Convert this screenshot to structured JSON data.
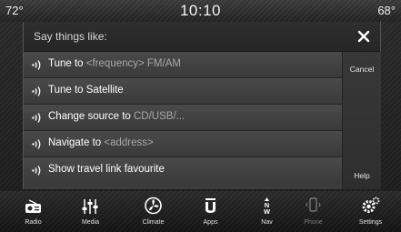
{
  "status_bar": {
    "temp_left": "72°",
    "clock": "10:10",
    "temp_right": "68°"
  },
  "dialog": {
    "title": "Say things like:",
    "commands": [
      {
        "label": "Tune to",
        "hint": "<frequency> FM/AM"
      },
      {
        "label": "Tune to Satellite",
        "hint": ""
      },
      {
        "label": "Change source to",
        "hint": "CD/USB/..."
      },
      {
        "label": "Navigate to",
        "hint": "<address>"
      },
      {
        "label": "Show travel link favourite",
        "hint": ""
      }
    ],
    "cancel_label": "Cancel",
    "help_label": "Help"
  },
  "nav": {
    "items": [
      {
        "label": "Radio",
        "icon": "radio-icon",
        "enabled": true
      },
      {
        "label": "Media",
        "icon": "media-icon",
        "enabled": true
      },
      {
        "label": "Climate",
        "icon": "climate-icon",
        "enabled": true
      },
      {
        "label": "Apps",
        "icon": "apps-icon",
        "enabled": true
      },
      {
        "label": "Nav",
        "icon": "nav-icon",
        "enabled": true
      },
      {
        "label": "Phone",
        "icon": "phone-icon",
        "enabled": false
      },
      {
        "label": "Settings",
        "icon": "settings-icon",
        "enabled": true
      }
    ]
  },
  "colors": {
    "background": "#222222",
    "dialog_row": "#454545",
    "hint_text": "#a8a8a8",
    "text": "#ffffff"
  }
}
